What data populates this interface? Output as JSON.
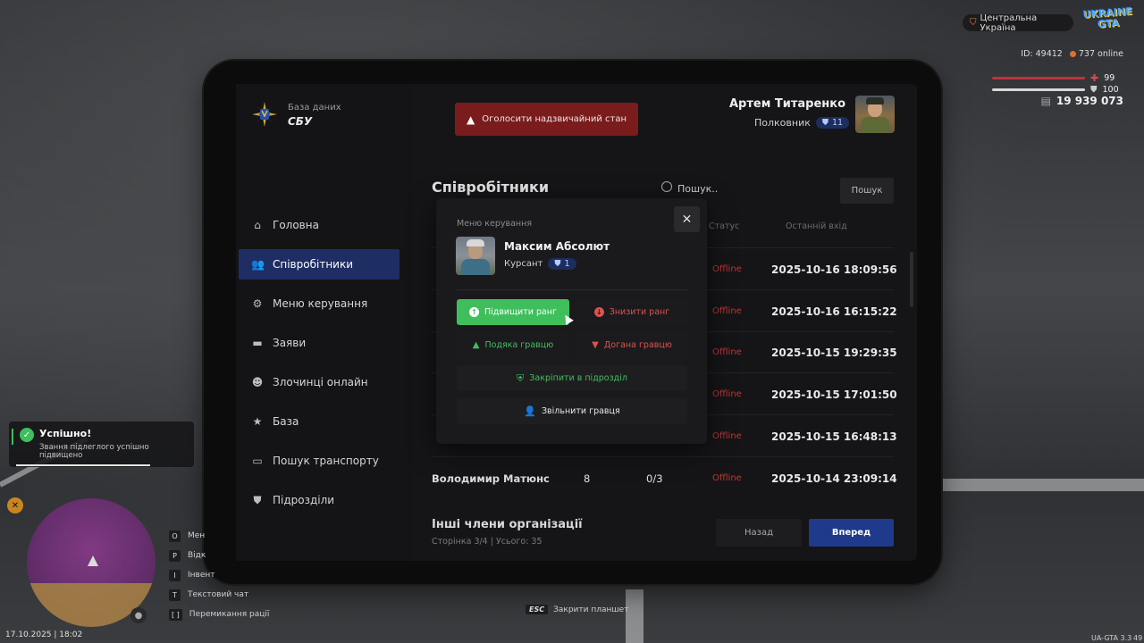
{
  "hud": {
    "region": "Центральна Україна",
    "logo": "UKRAINE GTA",
    "player_id": "ID: 49412",
    "online": "737 online",
    "health": "99",
    "armor": "100",
    "money": "19 939 073",
    "datetime": "17.10.2025 | 18:02",
    "version": "UA-GTA 3.3",
    "version_extra": "49"
  },
  "brand": {
    "subtitle": "База даних",
    "title": "СБУ"
  },
  "emergency_button": "Оголосити надзвичайний стан",
  "profile": {
    "name": "Артем Титаренко",
    "rank": "Полковник",
    "rank_level": "11"
  },
  "sidebar": {
    "items": [
      {
        "label": "Головна",
        "icon": "home-icon"
      },
      {
        "label": "Співробітники",
        "icon": "users-icon",
        "active": true
      },
      {
        "label": "Меню керування",
        "icon": "gear-icon"
      },
      {
        "label": "Заяви",
        "icon": "folder-icon"
      },
      {
        "label": "Злочинці онлайн",
        "icon": "mask-icon"
      },
      {
        "label": "База",
        "icon": "star-icon"
      },
      {
        "label": "Пошук транспорту",
        "icon": "car-icon"
      },
      {
        "label": "Підрозділи",
        "icon": "shield-icon"
      }
    ]
  },
  "employees": {
    "title": "Співробітники",
    "search_placeholder": "Пошук..",
    "search_button": "Пошук",
    "columns": {
      "status": "Статус",
      "last_login": "Останній вхід"
    },
    "rows": [
      {
        "name": "",
        "rank": "",
        "warns": "",
        "status": "Offline",
        "last_login": "2025-10-16 18:09:56"
      },
      {
        "name": "",
        "rank": "",
        "warns": "",
        "status": "Offline",
        "last_login": "2025-10-16 16:15:22"
      },
      {
        "name": "",
        "rank": "",
        "warns": "",
        "status": "Offline",
        "last_login": "2025-10-15 19:29:35"
      },
      {
        "name": "",
        "rank": "",
        "warns": "",
        "status": "Offline",
        "last_login": "2025-10-15 17:01:50"
      },
      {
        "name": "",
        "rank": "",
        "warns": "",
        "status": "Offline",
        "last_login": "2025-10-15 16:48:13"
      },
      {
        "name": "Володимир Матюнс",
        "rank": "8",
        "warns": "0/3",
        "status": "Offline",
        "last_login": "2025-10-14 23:09:14"
      }
    ],
    "others_title": "Інші члени організації",
    "pagination": "Сторінка 3/4 | Усього: 35",
    "back_button": "Назад",
    "next_button": "Вперед"
  },
  "modal": {
    "label": "Меню керування",
    "name": "Максим Абсолют",
    "rank": "Курсант",
    "rank_level": "1",
    "promote": "Підвищити ранг",
    "demote": "Знизити ранг",
    "thanks": "Подяка гравцю",
    "reprimand": "Догана гравцю",
    "assign": "Закріпити в підрозділ",
    "fire": "Звільнити гравця"
  },
  "toast": {
    "title": "Успішно!",
    "message": "Звання підлеглого успішно підвищено"
  },
  "hotkeys": [
    {
      "key": "O",
      "label": "Мен"
    },
    {
      "key": "P",
      "label": "Відк"
    },
    {
      "key": "I",
      "label": "Інвент"
    },
    {
      "key": "T",
      "label": "Текстовий чат"
    },
    {
      "key": "[ ]",
      "label": "Перемикання рації"
    }
  ],
  "esc_hint": {
    "key": "ESC",
    "label": "Закрити планшет"
  }
}
